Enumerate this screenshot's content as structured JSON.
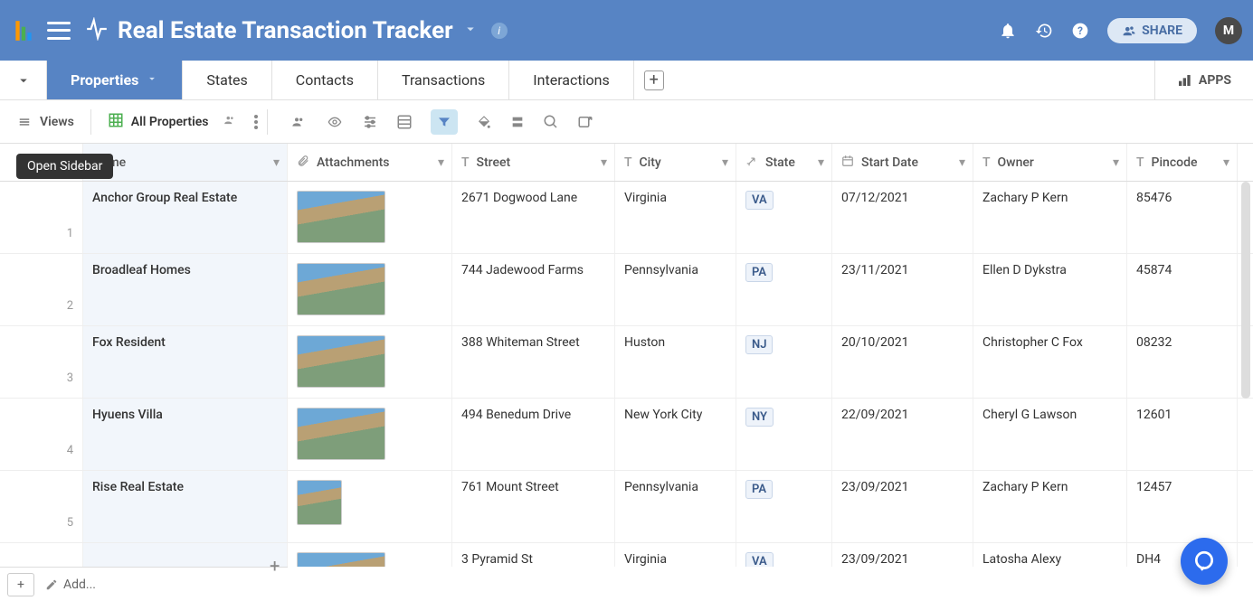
{
  "header": {
    "app_title": "Real Estate Transaction Tracker",
    "share_label": "SHARE",
    "avatar_initial": "M"
  },
  "tooltip": {
    "open_sidebar": "Open Sidebar"
  },
  "tabs": {
    "active": "Properties",
    "items": [
      "Properties",
      "States",
      "Contacts",
      "Transactions",
      "Interactions"
    ],
    "apps_label": "APPS"
  },
  "toolbar": {
    "views_label": "Views",
    "current_view": "All Properties"
  },
  "columns": {
    "name": "Name",
    "attachments": "Attachments",
    "street": "Street",
    "city": "City",
    "state": "State",
    "start_date": "Start Date",
    "owner": "Owner",
    "pincode": "Pincode"
  },
  "rows": [
    {
      "num": "1",
      "name": "Anchor Group Real Estate",
      "street": "2671 Dogwood Lane",
      "city": "Virginia",
      "state": "VA",
      "date": "07/12/2021",
      "owner": "Zachary P Kern",
      "pin": "85476"
    },
    {
      "num": "2",
      "name": "Broadleaf Homes",
      "street": "744 Jadewood Farms",
      "city": "Pennsylvania",
      "state": "PA",
      "date": "23/11/2021",
      "owner": "Ellen D Dykstra",
      "pin": "45874"
    },
    {
      "num": "3",
      "name": "Fox Resident",
      "street": "388 Whiteman Street",
      "city": "Huston",
      "state": "NJ",
      "date": "20/10/2021",
      "owner": "Christopher C Fox",
      "pin": "08232"
    },
    {
      "num": "4",
      "name": "Hyuens Villa",
      "street": "494 Benedum Drive",
      "city": "New York City",
      "state": "NY",
      "date": "22/09/2021",
      "owner": "Cheryl G Lawson",
      "pin": "12601"
    },
    {
      "num": "5",
      "name": "Rise Real Estate",
      "street": "761 Mount Street",
      "city": "Pennsylvania",
      "state": "PA",
      "date": "23/09/2021",
      "owner": "Zachary P Kern",
      "pin": "12457"
    },
    {
      "num": "",
      "name": "",
      "street": "3 Pyramid St",
      "city": "Virginia",
      "state": "VA",
      "date": "23/09/2021",
      "owner": "Latosha Alexy",
      "pin": "DH4"
    }
  ],
  "footer": {
    "add_label": "Add..."
  }
}
